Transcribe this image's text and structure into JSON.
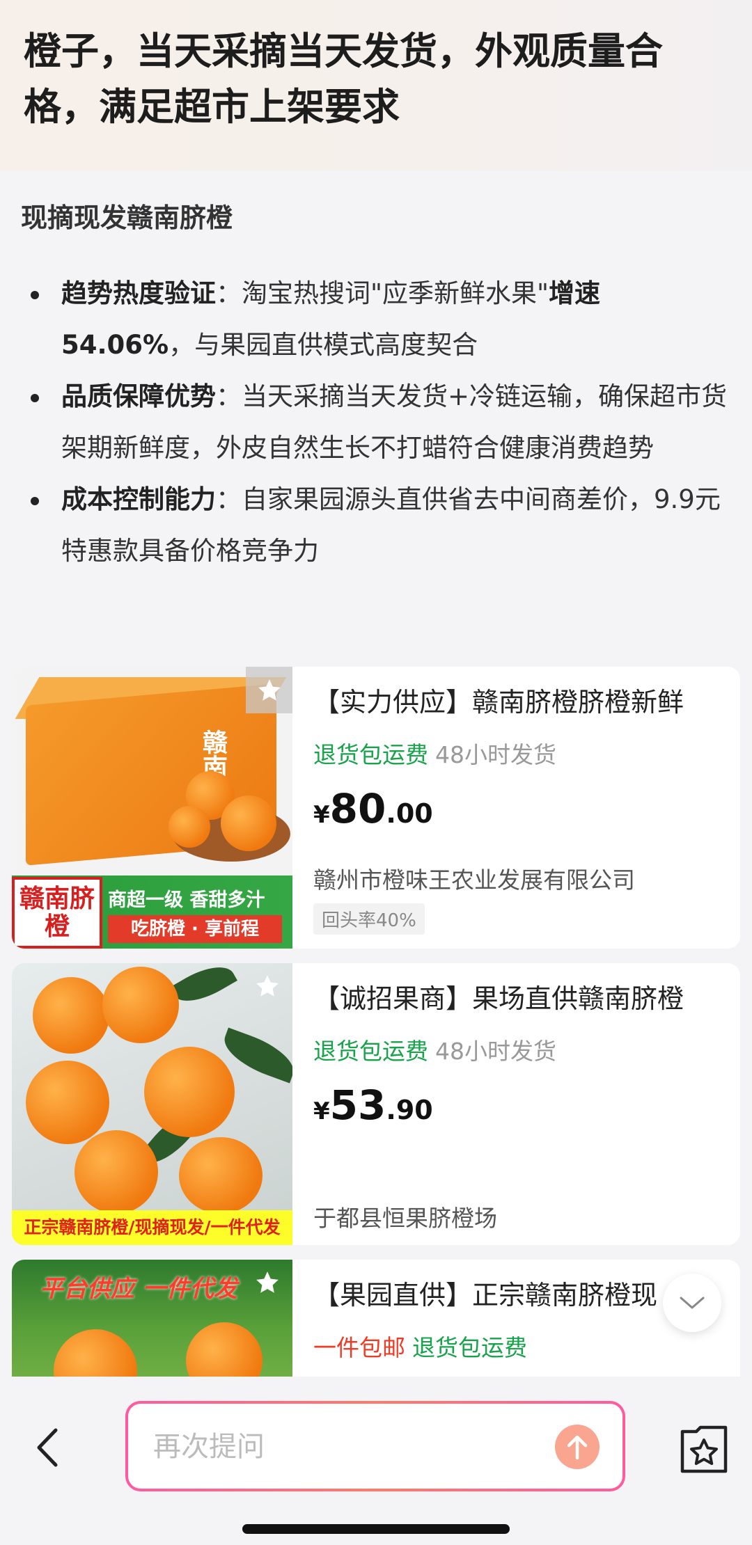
{
  "header": {
    "title": "橙子，当天采摘当天发货，外观质量合格，满足超市上架要求"
  },
  "summary": {
    "subtitle": "现摘现发赣南脐橙",
    "points": [
      {
        "label": "趋势热度验证",
        "sep": "：",
        "text_a": "淘宝热搜词\"应季新鲜水果\"",
        "strong": "增速54.06%",
        "text_b": "，与果园直供模式高度契合"
      },
      {
        "label": "品质保障优势",
        "sep": "：",
        "text": "当天采摘当天发货+冷链运输，确保超市货架期新鲜度，外皮自然生长不打蜡符合健康消费趋势"
      },
      {
        "label": "成本控制能力",
        "sep": "：",
        "text": "自家果园源头直供省去中间商差价，9.9元特惠款具备价格竞争力"
      }
    ]
  },
  "products": [
    {
      "title": "【实力供应】赣南脐橙脐橙新鲜",
      "tag_green": "退货包运费",
      "tag_grey": "48小时发货",
      "currency": "¥",
      "price_int": "80",
      "price_dec": ".00",
      "seller": "赣州市橙味王农业发展有限公司",
      "badge": "回头率40%",
      "thumb": {
        "box_title": "赣南脐橙",
        "left_label": "赣南脐橙",
        "band_top": "商超一级  香甜多汁",
        "band_bottom": "吃脐橙 · 享前程"
      }
    },
    {
      "title": "【诚招果商】果场直供赣南脐橙",
      "tag_green": "退货包运费",
      "tag_grey": "48小时发货",
      "currency": "¥",
      "price_int": "53",
      "price_dec": ".90",
      "seller": "于都县恒果脐橙场",
      "thumb": {
        "caption": "正宗赣南脐橙/现摘现发/一件代发"
      }
    },
    {
      "title": "【果园直供】正宗赣南脐橙现",
      "tag_red": "一件包邮",
      "tag_green": "退货包运费",
      "thumb": {
        "caption": "平台供应  一件代发"
      }
    }
  ],
  "bottombar": {
    "input_placeholder": "再次提问"
  },
  "colors": {
    "accent_green": "#16a34a",
    "accent_red": "#ef3b24",
    "send_button": "#f9a58f",
    "input_border": "#ff5aa0"
  },
  "icons": [
    "star-icon",
    "chevron-down-icon",
    "back-arrow-icon",
    "send-arrow-icon",
    "favorites-folder-icon"
  ]
}
